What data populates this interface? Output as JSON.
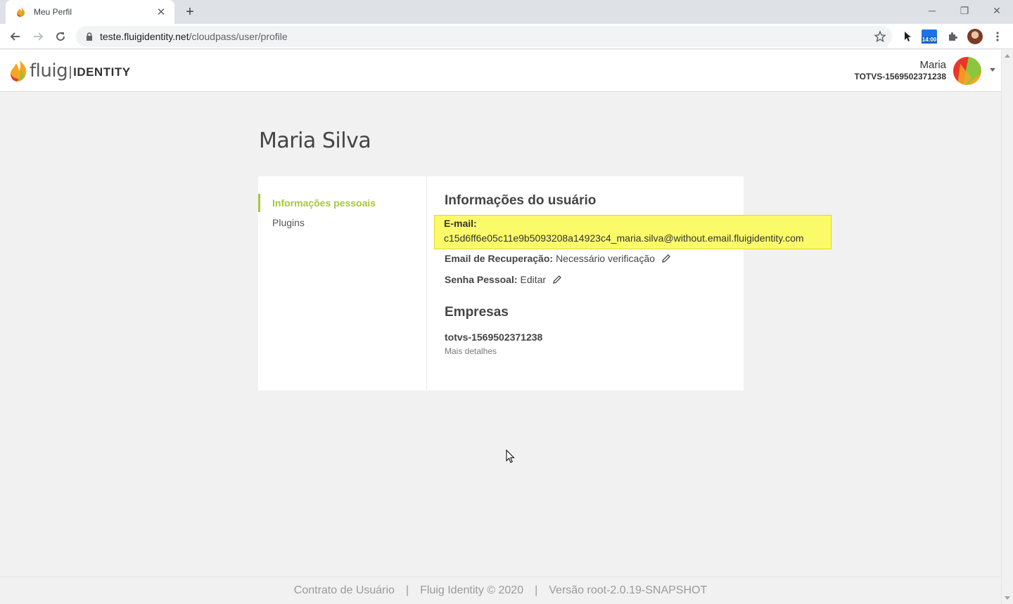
{
  "browser": {
    "tab_title": "Meu Perfil",
    "url_host": "teste.fluigidentity.net",
    "url_path": "/cloudpass/user/profile",
    "extension_badge": "14:00",
    "icons": {
      "back": "back-arrow-icon",
      "forward": "forward-arrow-icon",
      "reload": "reload-icon",
      "lock": "lock-icon",
      "bookmark": "star-icon",
      "extensions": "puzzle-icon",
      "menu": "kebab-menu-icon"
    }
  },
  "header": {
    "brand_left": "fluig",
    "brand_right": "IDENTITY",
    "user_name": "Maria",
    "tenant": "TOTVS-1569502371238"
  },
  "page": {
    "title": "Maria Silva"
  },
  "side_nav": {
    "items": [
      {
        "label": "Informações pessoais",
        "active": true
      },
      {
        "label": "Plugins",
        "active": false
      }
    ]
  },
  "user_info": {
    "heading": "Informações do usuário",
    "email_label": "E-mail:",
    "email_value": "c15d6ff6e05c11e9b5093208a14923c4_maria.silva@without.email.fluigidentity.com",
    "recovery_label": "Email de Recuperação:",
    "recovery_value": "Necessário verificação",
    "password_label": "Senha Pessoal:",
    "password_value": "Editar"
  },
  "companies": {
    "heading": "Empresas",
    "items": [
      {
        "id": "totvs-1569502371238",
        "link": "Mais detalhes"
      }
    ]
  },
  "footer": {
    "contract": "Contrato de Usuário",
    "copyright": "Fluig Identity © 2020",
    "version": "Versão root-2.0.19-SNAPSHOT",
    "separator": "|"
  },
  "colors": {
    "accent_green": "#a5c83a",
    "highlight_yellow": "#fbfb6a",
    "page_bg": "#f1f1f1"
  }
}
